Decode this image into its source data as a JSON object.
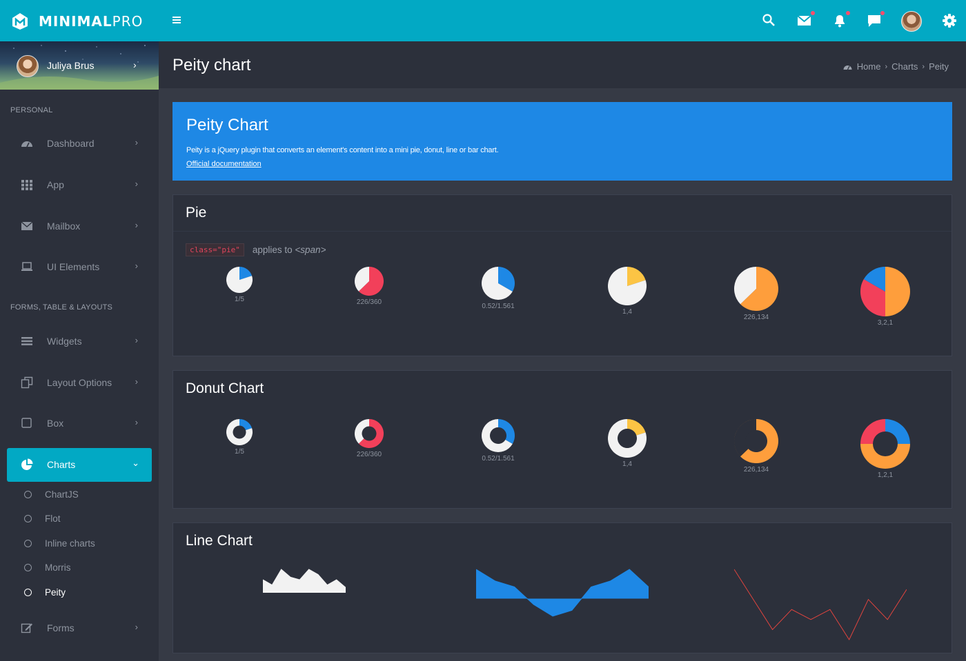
{
  "brand": {
    "name_bold": "MINIMAL",
    "name_light": "PRO"
  },
  "user": {
    "name": "Juliya Brus"
  },
  "sidebar": {
    "sections": [
      "PERSONAL",
      "FORMS, TABLE & LAYOUTS"
    ],
    "items": [
      {
        "label": "Dashboard",
        "icon": "dashboard-icon"
      },
      {
        "label": "App",
        "icon": "grid-icon"
      },
      {
        "label": "Mailbox",
        "icon": "envelope-icon"
      },
      {
        "label": "UI Elements",
        "icon": "laptop-icon"
      },
      {
        "label": "Widgets",
        "icon": "bars-icon"
      },
      {
        "label": "Layout Options",
        "icon": "copy-icon"
      },
      {
        "label": "Box",
        "icon": "square-icon"
      },
      {
        "label": "Charts",
        "icon": "pie-chart-icon",
        "active": true
      },
      {
        "label": "Forms",
        "icon": "edit-icon"
      }
    ],
    "chart_subitems": [
      "ChartJS",
      "Flot",
      "Inline charts",
      "Morris",
      "Peity"
    ],
    "active_subitem": "Peity"
  },
  "page": {
    "title": "Peity chart",
    "breadcrumb": [
      "Home",
      "Charts",
      "Peity"
    ]
  },
  "hero": {
    "title": "Peity Chart",
    "description": "Peity is a jQuery plugin that converts an element's content into a mini pie, donut, line or bar chart.",
    "link": "Official documentation"
  },
  "pie_card": {
    "title": "Pie",
    "code": "class=\"pie\"",
    "note_prefix": "applies to ",
    "note_tag": "<span>"
  },
  "donut_card": {
    "title": "Donut Chart"
  },
  "line_card": {
    "title": "Line Chart"
  },
  "colors": {
    "topbar": "#02a9c4",
    "blue": "#1e88e5",
    "red": "#f2405a",
    "yellow": "#fcc444",
    "orange": "#fe9e3c",
    "light": "#f2f2f2",
    "line_red": "#e0443e"
  },
  "chart_data": [
    {
      "type": "pie",
      "title": "Pie",
      "charts": [
        {
          "label": "1/5",
          "values": [
            1,
            4
          ],
          "colors": [
            "#1e88e5",
            "#f2f2f2"
          ]
        },
        {
          "label": "226/360",
          "values": [
            226,
            134
          ],
          "colors": [
            "#f2405a",
            "#f2f2f2"
          ]
        },
        {
          "label": "0.52/1.561",
          "values": [
            0.52,
            1.041
          ],
          "colors": [
            "#1e88e5",
            "#f2f2f2"
          ]
        },
        {
          "label": "1,4",
          "values": [
            1,
            4
          ],
          "colors": [
            "#fcc444",
            "#f2f2f2"
          ]
        },
        {
          "label": "226,134",
          "values": [
            226,
            134
          ],
          "colors": [
            "#fe9e3c",
            "#f2f2f2"
          ]
        },
        {
          "label": "3,2,1",
          "values": [
            3,
            2,
            1
          ],
          "colors": [
            "#fe9e3c",
            "#f2405a",
            "#1e88e5"
          ]
        }
      ]
    },
    {
      "type": "donut",
      "title": "Donut Chart",
      "charts": [
        {
          "label": "1/5",
          "values": [
            1,
            4
          ],
          "colors": [
            "#1e88e5",
            "#f2f2f2"
          ]
        },
        {
          "label": "226/360",
          "values": [
            226,
            134
          ],
          "colors": [
            "#f2405a",
            "#f2f2f2"
          ]
        },
        {
          "label": "0.52/1.561",
          "values": [
            0.52,
            1.041
          ],
          "colors": [
            "#1e88e5",
            "#f2f2f2"
          ]
        },
        {
          "label": "1,4",
          "values": [
            1,
            4
          ],
          "colors": [
            "#fcc444",
            "#f2f2f2"
          ]
        },
        {
          "label": "226,134",
          "values": [
            226,
            134
          ],
          "colors": [
            "#fe9e3c",
            "#2c303b"
          ]
        },
        {
          "label": "1,2,1",
          "values": [
            1,
            2,
            1
          ],
          "colors": [
            "#1e88e5",
            "#fe9e3c",
            "#f2405a"
          ]
        }
      ]
    },
    {
      "type": "line",
      "title": "Line Chart",
      "charts": [
        {
          "values": [
            5,
            3,
            9,
            6,
            5,
            9,
            7,
            3,
            5,
            2
          ],
          "fill": "#f2f2f2",
          "stroke": "#f2f2f2"
        },
        {
          "values": [
            5,
            3,
            2,
            -1,
            -3,
            -2,
            2,
            3,
            5,
            2
          ],
          "fill": "#1e88e5",
          "stroke": "#1e88e5"
        },
        {
          "values": [
            0,
            -3,
            -6,
            -4,
            -5,
            -4,
            -7,
            -3,
            -5,
            -2
          ],
          "fill": "none",
          "stroke": "#e0443e"
        }
      ]
    }
  ]
}
